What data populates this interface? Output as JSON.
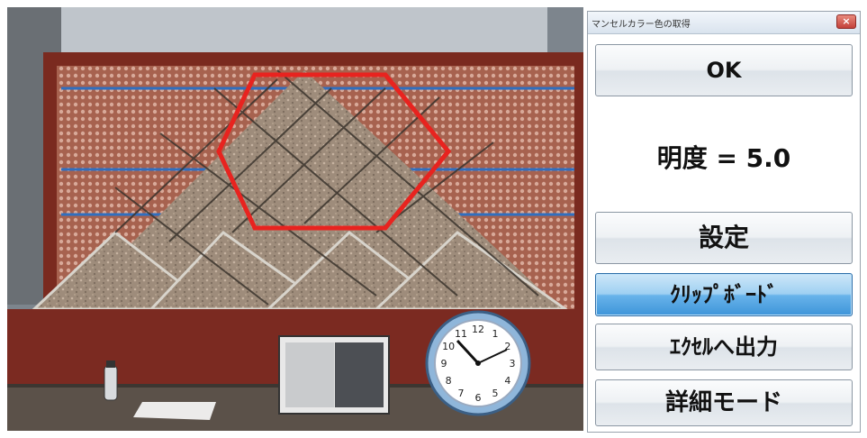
{
  "window": {
    "title": "マンセルカラー色の取得",
    "close_label": "×"
  },
  "buttons": {
    "ok": "OK",
    "setting": "設定",
    "clipboard": "ｸﾘｯﾌﾟﾎﾞｰﾄﾞ",
    "excel": "ｴｸｾﾙへ出力",
    "detail": "詳細モード"
  },
  "readout": {
    "text": "明度 = 5.0",
    "value": 5.0
  },
  "photo": {
    "clock_hours": [
      "12",
      "1",
      "2",
      "3",
      "4",
      "5",
      "6",
      "7",
      "8",
      "9",
      "10",
      "11"
    ]
  },
  "colors": {
    "selection_hexagon": "#e8231f",
    "active_button": "#3e95d9",
    "frame_red": "#8e2a1d"
  }
}
